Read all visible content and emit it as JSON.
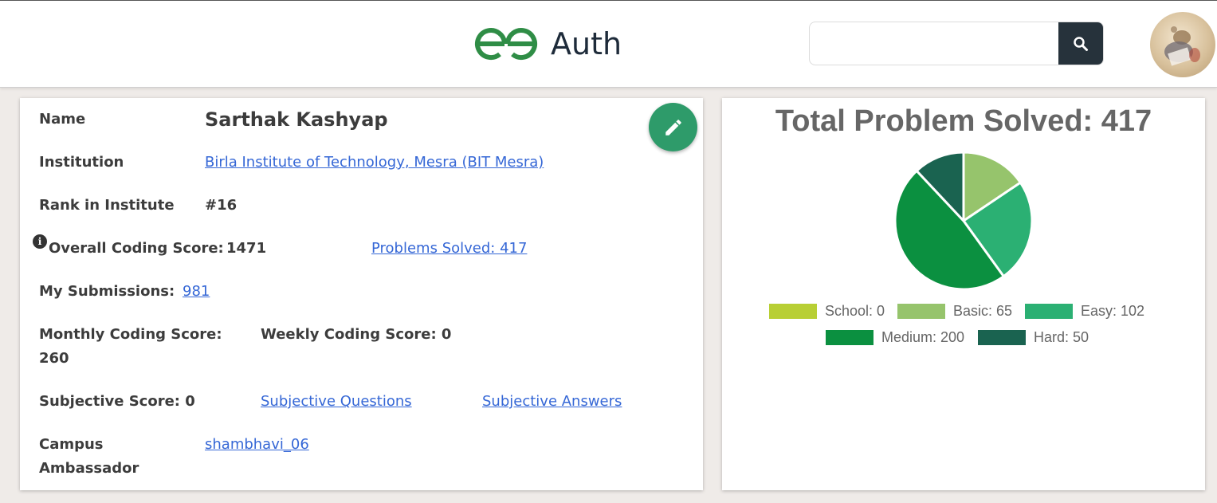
{
  "header": {
    "logo_text": "Auth",
    "search": {
      "placeholder": "",
      "value": ""
    }
  },
  "profile": {
    "name_label": "Name",
    "name_value": "Sarthak Kashyap",
    "institution_label": "Institution",
    "institution_value": "Birla Institute of Technology, Mesra (BIT Mesra)",
    "rank_label": "Rank in Institute",
    "rank_value": "#16",
    "overall_label": "Overall Coding Score:",
    "overall_value": "1471",
    "problems_solved_link": "Problems Solved: 417",
    "submissions_label": "My Submissions:",
    "submissions_value": "981",
    "monthly_label_line1": "Monthly Coding Score:",
    "monthly_value": "260",
    "weekly_label": "Weekly Coding Score: 0",
    "subjective_score": "Subjective Score: 0",
    "subjective_questions_link": "Subjective Questions",
    "subjective_answers_link": "Subjective Answers",
    "campus_label_line1": "Campus",
    "campus_label_line2": "Ambassador",
    "campus_value": "shambhavi_06"
  },
  "chart_data": {
    "type": "pie",
    "title": "Total Problem Solved: 417",
    "categories": [
      "School",
      "Basic",
      "Easy",
      "Medium",
      "Hard"
    ],
    "values": [
      0,
      65,
      102,
      200,
      50
    ],
    "legend_labels": [
      "School: 0",
      "Basic: 65",
      "Easy: 102",
      "Medium: 200",
      "Hard: 50"
    ],
    "colors": [
      "#b8cf34",
      "#96c46c",
      "#2bb073",
      "#0b9040",
      "#1a6350"
    ],
    "legend_placement": "bottom"
  },
  "colors": {
    "link": "#3567d6",
    "edit_button": "#2e9b6a",
    "logo_green": "#2f8d46",
    "search_button": "#26323b"
  },
  "icons": {
    "search": "search-icon",
    "edit": "pencil-icon",
    "info": "info-icon"
  }
}
